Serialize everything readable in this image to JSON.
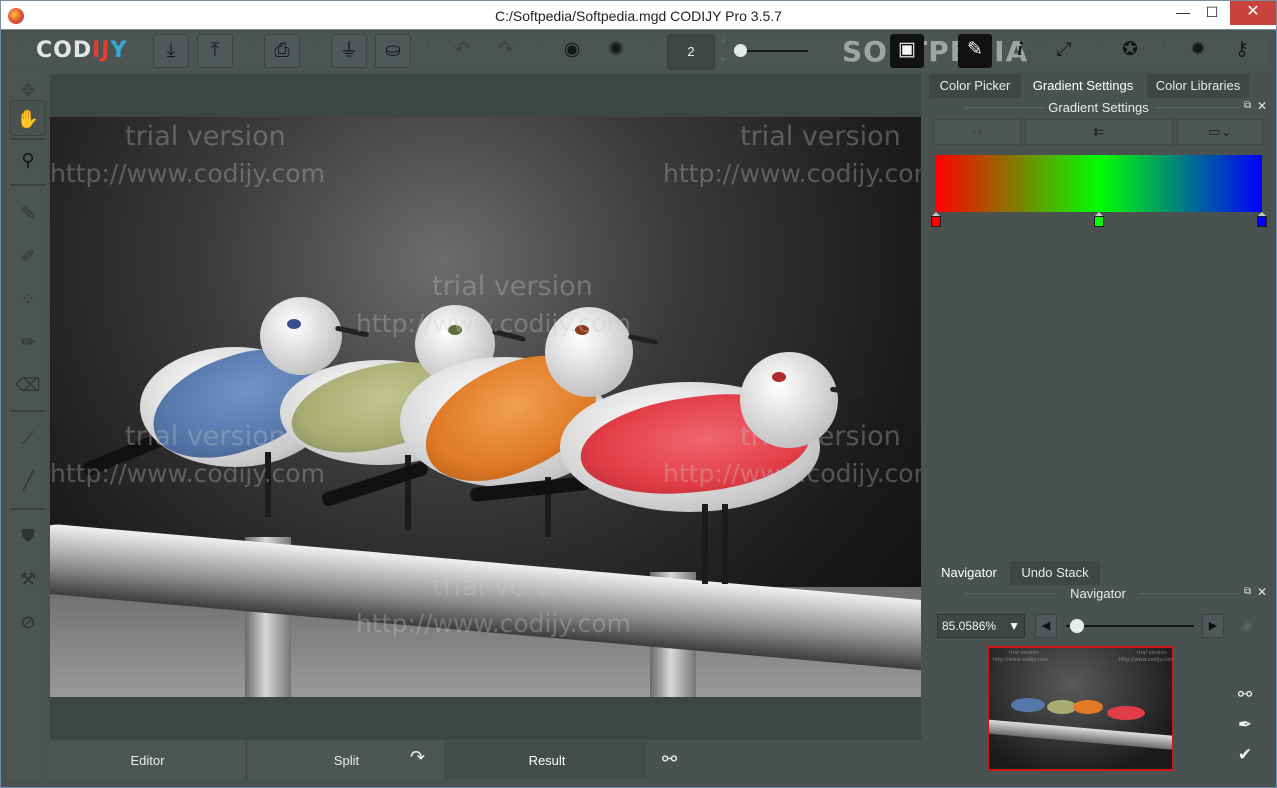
{
  "window": {
    "title": "C:/Softpedia/Softpedia.mgd CODIJY Pro 3.5.7",
    "minimize": "—",
    "maximize": "☐",
    "close": "✕"
  },
  "toolbar": {
    "logo": [
      "COD",
      "I",
      "J",
      "Y"
    ],
    "brush_size": "2",
    "brush_slider_fraction": 0.05,
    "watermark_text": "SOFTPEDIA"
  },
  "canvas": {
    "watermarks": {
      "trial": "trial version",
      "url": "http://www.codijy.com"
    }
  },
  "bottom_tabs": {
    "editor": "Editor",
    "split": "Split",
    "result": "Result"
  },
  "right_panel": {
    "tabs": [
      "Color Picker",
      "Gradient Settings",
      "Color Libraries"
    ],
    "active_tab": "Gradient Settings",
    "panel_title": "Gradient Settings",
    "gradient": {
      "stops": [
        {
          "position": 0.0,
          "color": "#ff0000"
        },
        {
          "position": 0.5,
          "color": "#00ff00"
        },
        {
          "position": 1.0,
          "color": "#0000ff"
        }
      ]
    },
    "nav_tabs": [
      "Navigator",
      "Undo Stack"
    ],
    "nav_active_tab": "Navigator",
    "navigator_title": "Navigator",
    "zoom": "85.0586%",
    "zoom_slider_fraction": 0.05
  },
  "colors": {
    "bird_blue": "#5577aa",
    "bird_olive": "#a7ad72",
    "bird_orange": "#e07a26",
    "bird_red": "#e23d47",
    "accent_red_border": "#d01818"
  }
}
